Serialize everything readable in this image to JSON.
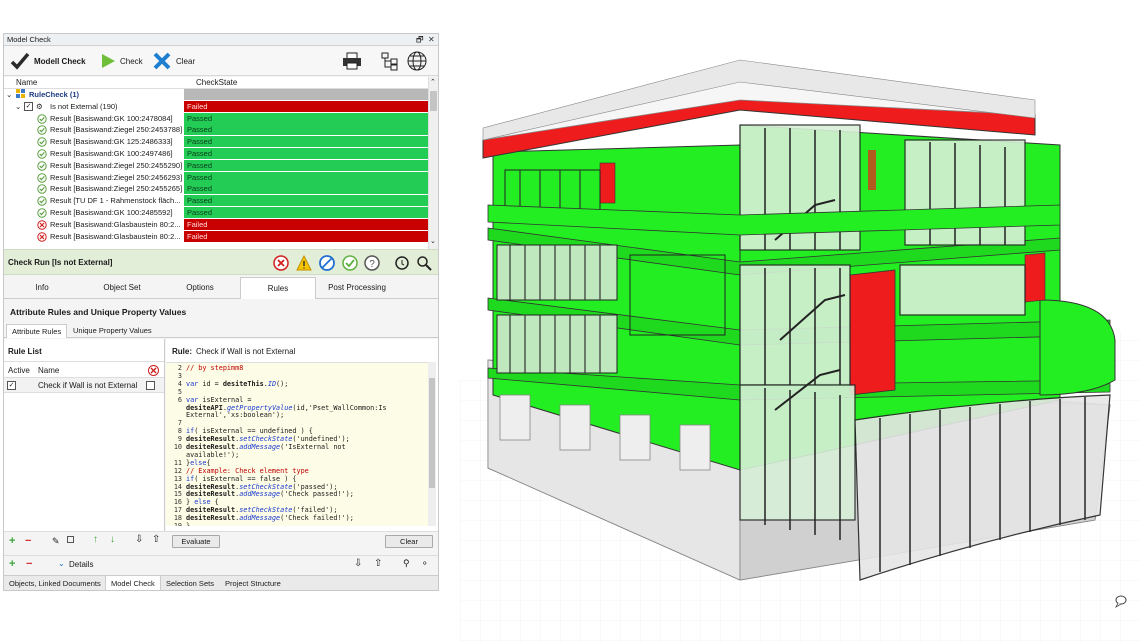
{
  "window": {
    "title": "Model Check",
    "pin_icon": "pin-icon",
    "close_icon": "close-icon"
  },
  "toolbar": {
    "modell_check_label": "Modell Check",
    "check_label": "Check",
    "clear_label": "Clear"
  },
  "tree": {
    "columns": [
      "Name",
      "CheckState"
    ],
    "root_label": "RuleCheck (1)",
    "group_label": "Is not External (190)",
    "group_state": "Failed",
    "rows": [
      {
        "name": "Result [Basiswand:GK 100:2478084]",
        "state": "Passed",
        "status": "pass"
      },
      {
        "name": "Result [Basiswand:Ziegel 250:2453788]",
        "state": "Passed",
        "status": "pass"
      },
      {
        "name": "Result [Basiswand:GK 125:2486333]",
        "state": "Passed",
        "status": "pass"
      },
      {
        "name": "Result [Basiswand:GK 100:2497486]",
        "state": "Passed",
        "status": "pass"
      },
      {
        "name": "Result [Basiswand:Ziegel 250:2455290]",
        "state": "Passed",
        "status": "pass"
      },
      {
        "name": "Result [Basiswand:Ziegel 250:2456293]",
        "state": "Passed",
        "status": "pass"
      },
      {
        "name": "Result [Basiswand:Ziegel 250:2455265]",
        "state": "Passed",
        "status": "pass"
      },
      {
        "name": "Result [TU DF 1 - Rahmenstock fläch...",
        "state": "Passed",
        "status": "pass"
      },
      {
        "name": "Result [Basiswand:GK 100:2485592]",
        "state": "Passed",
        "status": "pass"
      },
      {
        "name": "Result [Basiswand:Glasbaustein 80:2...",
        "state": "Failed",
        "status": "fail"
      },
      {
        "name": "Result [Basiswand:Glasbaustein 80:2...",
        "state": "Failed",
        "status": "fail"
      }
    ]
  },
  "check_run": {
    "label": "Check Run [Is not External]"
  },
  "tabs": [
    "Info",
    "Object Set",
    "Options",
    "Rules",
    "Post Processing"
  ],
  "active_tab": "Rules",
  "section_title": "Attribute Rules and Unique Property Values",
  "subtabs": [
    "Attribute Rules",
    "Unique Property Values"
  ],
  "rule_list": {
    "title": "Rule List",
    "col_active": "Active",
    "col_name": "Name",
    "items": [
      {
        "name": "Check if Wall is not External",
        "active": true
      }
    ]
  },
  "rule": {
    "label": "Rule:",
    "name": "Check if Wall is not External"
  },
  "code_lines": [
    {
      "n": "2",
      "html": "<span class='cm'>// by stepimm8</span>"
    },
    {
      "n": "3",
      "html": ""
    },
    {
      "n": "4",
      "html": "<span class='kw'>var</span> id = <span class='obj'>desiteThis</span>.<span class='fn'>ID</span>();"
    },
    {
      "n": "5",
      "html": ""
    },
    {
      "n": "6",
      "html": "<span class='kw'>var</span> isExternal ="
    },
    {
      "n": "",
      "html": "<span class='obj'>desiteAPI</span>.<span class='fn'>getPropertyValue</span>(id,'Pset_WallCommon:Is"
    },
    {
      "n": "",
      "html": "External','xs:boolean');"
    },
    {
      "n": "7",
      "html": ""
    },
    {
      "n": "8",
      "html": "<span class='kw'>if</span>( isExternal == undefined ) {"
    },
    {
      "n": "9",
      "html": "   <span class='obj'>desiteResult</span>.<span class='fn'>setCheckState</span>('undefined');"
    },
    {
      "n": "10",
      "html": "   <span class='obj'>desiteResult</span>.<span class='fn'>addMessage</span>('IsExternal not"
    },
    {
      "n": "",
      "html": "available!');"
    },
    {
      "n": "11",
      "html": "}<span class='kw'>else</span>{"
    },
    {
      "n": "12",
      "html": "   <span class='cm'>// Example: Check element type</span>"
    },
    {
      "n": "13",
      "html": "   <span class='kw'>if</span>( isExternal == false ) {"
    },
    {
      "n": "14",
      "html": "      <span class='obj'>desiteResult</span>.<span class='fn'>setCheckState</span>('passed');"
    },
    {
      "n": "15",
      "html": "      <span class='obj'>desiteResult</span>.<span class='fn'>addMessage</span>('Check passed!');"
    },
    {
      "n": "16",
      "html": "   } <span class='kw'>else</span> {"
    },
    {
      "n": "17",
      "html": "      <span class='obj'>desiteResult</span>.<span class='fn'>setCheckState</span>('failed');"
    },
    {
      "n": "18",
      "html": "      <span class='obj'>desiteResult</span>.<span class='fn'>addMessage</span>('Check failed!');"
    },
    {
      "n": "19",
      "html": "   }"
    }
  ],
  "buttons": {
    "evaluate": "Evaluate",
    "clear": "Clear",
    "details": "Details"
  },
  "bottom_tabs": [
    "Objects, Linked Documents",
    "Model Check",
    "Selection Sets",
    "Project Structure"
  ],
  "active_bottom_tab": "Model Check",
  "colors": {
    "passed": "#22cc55",
    "failed": "#c80000",
    "building_green": "#22ee22",
    "building_red": "#ee1c1c"
  }
}
